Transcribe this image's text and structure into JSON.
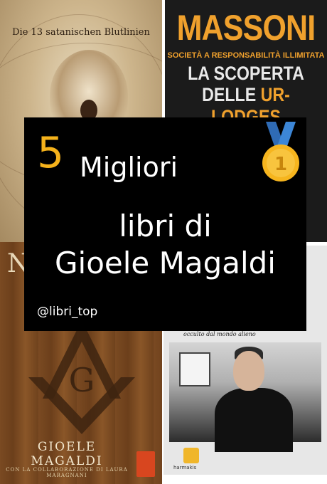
{
  "covers": {
    "top_left": {
      "title": "Die 13 satanischen Blutlinien"
    },
    "top_right": {
      "line1": "MASSONI",
      "line2": "SOCIETÀ A RESPONSABILITÀ ILLIMITATA",
      "line3": "LA SCOPERTA",
      "line4_a": "DELLE ",
      "line4_b": "UR-LODGES",
      "accent_color": "#f0a12d"
    },
    "bottom_left": {
      "top_letter": "N",
      "emblem_letter": "G",
      "author": "GIOELE MAGALDI",
      "collab": "CON LA COLLABORAZIONE DI LAURA MARAGNANI"
    },
    "bottom_right": {
      "top_text": "occulto dal mondo alieno",
      "publisher": "harmakis"
    }
  },
  "overlay": {
    "number": "5",
    "word1": "Migliori",
    "line2": "libri di",
    "line3": "Gioele Magaldi",
    "handle": "@libri_top",
    "medal_icon": "first-place-medal-icon",
    "medal_text": "1",
    "number_color": "#f5b21b"
  }
}
